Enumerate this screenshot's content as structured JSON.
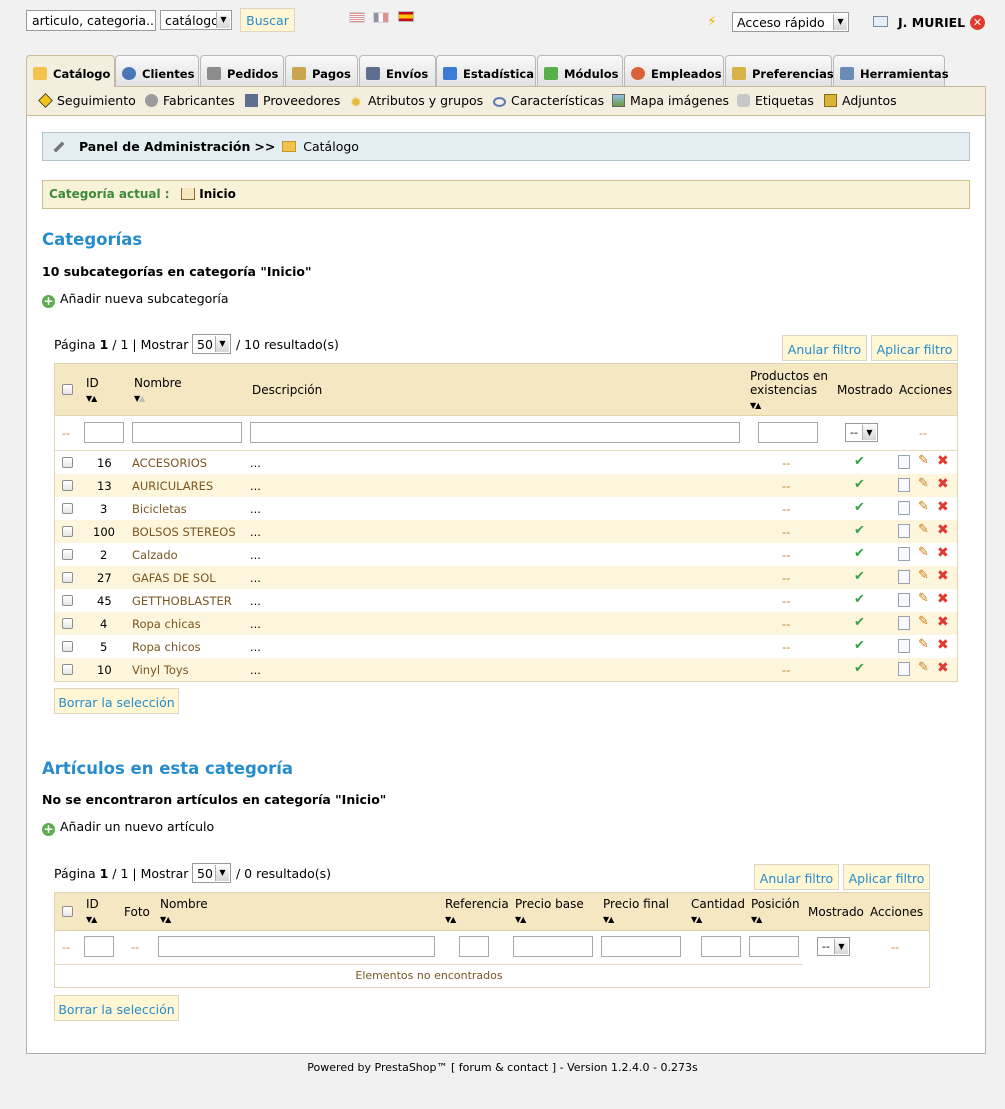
{
  "topbar": {
    "search_value": "articulo, categoria...",
    "search_scope": "catálogo",
    "search_button": "Buscar",
    "quick_access": "Acceso rápido",
    "user_name": "J. MURIEL"
  },
  "tabs": [
    {
      "label": "Catálogo",
      "icon": "folder-icon",
      "color": "#f2c24e"
    },
    {
      "label": "Clientes",
      "icon": "user-icon",
      "color": "#4a78b7"
    },
    {
      "label": "Pedidos",
      "icon": "cart-icon",
      "color": "#8c8c8c"
    },
    {
      "label": "Pagos",
      "icon": "payment-icon",
      "color": "#c9a64e"
    },
    {
      "label": "Envíos",
      "icon": "truck-icon",
      "color": "#5d6e8f"
    },
    {
      "label": "Estadística",
      "icon": "chart-icon",
      "color": "#3a7bd5"
    },
    {
      "label": "Módulos",
      "icon": "puzzle-icon",
      "color": "#58b04a"
    },
    {
      "label": "Empleados",
      "icon": "employee-icon",
      "color": "#d9623a"
    },
    {
      "label": "Preferencias",
      "icon": "preferences-icon",
      "color": "#d7b247"
    },
    {
      "label": "Herramientas",
      "icon": "wrench-icon",
      "color": "#6d8cb5"
    }
  ],
  "subtabs": [
    {
      "label": "Seguimiento",
      "icon": "warning-icon",
      "color": "#f0c419"
    },
    {
      "label": "Fabricantes",
      "icon": "gear-icon",
      "color": "#9a9a9a"
    },
    {
      "label": "Proveedores",
      "icon": "truck-icon",
      "color": "#5d6e8f"
    },
    {
      "label": "Atributos y grupos",
      "icon": "star-icon",
      "color": "#e8b93a"
    },
    {
      "label": "Características",
      "icon": "eye-icon",
      "color": "#5a78b5"
    },
    {
      "label": "Mapa imágenes",
      "icon": "image-icon",
      "color": "#6b9a3d"
    },
    {
      "label": "Etiquetas",
      "icon": "tag-icon",
      "color": "#b0b0b0"
    },
    {
      "label": "Adjuntos",
      "icon": "attachment-icon",
      "color": "#d9b33a"
    }
  ],
  "breadcrumb": {
    "root": "Panel de Administración",
    "separator": ">>",
    "current": "Catálogo"
  },
  "current_category": {
    "label": "Categoría actual :",
    "value": "Inicio"
  },
  "categories": {
    "title": "Categorías",
    "summary": "10 subcategorías en categoría \"Inicio\"",
    "add_label": "Añadir nueva subcategoría",
    "pagination": {
      "page_label": "Página",
      "page": "1",
      "of": "1",
      "show_label": "Mostrar",
      "per_page": "50",
      "results": "/ 10 resultado(s)"
    },
    "reset_filter": "Anular filtro",
    "apply_filter": "Aplicar filtro",
    "columns": {
      "id": "ID",
      "name": "Nombre",
      "description": "Descripción",
      "stock_line1": "Productos en",
      "stock_line2": "existencias",
      "shown": "Mostrado",
      "actions": "Acciones"
    },
    "filter_placeholder": "--",
    "rows": [
      {
        "id": "16",
        "name": "ACCESORIOS",
        "description": "...",
        "stock": "--"
      },
      {
        "id": "13",
        "name": "AURICULARES",
        "description": "...",
        "stock": "--"
      },
      {
        "id": "3",
        "name": "Bicicletas",
        "description": "...",
        "stock": "--"
      },
      {
        "id": "100",
        "name": "BOLSOS STEREOS",
        "description": "...",
        "stock": "--"
      },
      {
        "id": "2",
        "name": "Calzado",
        "description": "...",
        "stock": "--"
      },
      {
        "id": "27",
        "name": "GAFAS DE SOL",
        "description": "...",
        "stock": "--"
      },
      {
        "id": "45",
        "name": "GETTHOBLASTER",
        "description": "...",
        "stock": "--"
      },
      {
        "id": "4",
        "name": "Ropa chicas",
        "description": "...",
        "stock": "--"
      },
      {
        "id": "5",
        "name": "Ropa chicos",
        "description": "...",
        "stock": "--"
      },
      {
        "id": "10",
        "name": "Vinyl Toys",
        "description": "...",
        "stock": "--"
      }
    ],
    "clear_selection": "Borrar la selección"
  },
  "products": {
    "title": "Artículos en esta categoría",
    "summary": "No se encontraron artículos en categoría \"Inicio\"",
    "add_label": "Añadir un nuevo artículo",
    "pagination": {
      "page_label": "Página",
      "page": "1",
      "of": "1",
      "show_label": "Mostrar",
      "per_page": "50",
      "results": "/ 0 resultado(s)"
    },
    "reset_filter": "Anular filtro",
    "apply_filter": "Aplicar filtro",
    "columns": {
      "id": "ID",
      "photo": "Foto",
      "name": "Nombre",
      "reference": "Referencia",
      "base_price": "Precio base",
      "final_price": "Precio final",
      "quantity": "Cantidad",
      "position": "Posición",
      "shown": "Mostrado",
      "actions": "Acciones"
    },
    "filter_placeholder": "--",
    "empty_message": "Elementos no encontrados",
    "clear_selection": "Borrar la selección"
  },
  "footer": "Powered by PrestaShop™ [ forum & contact ] - Version 1.2.4.0 - 0.273s"
}
